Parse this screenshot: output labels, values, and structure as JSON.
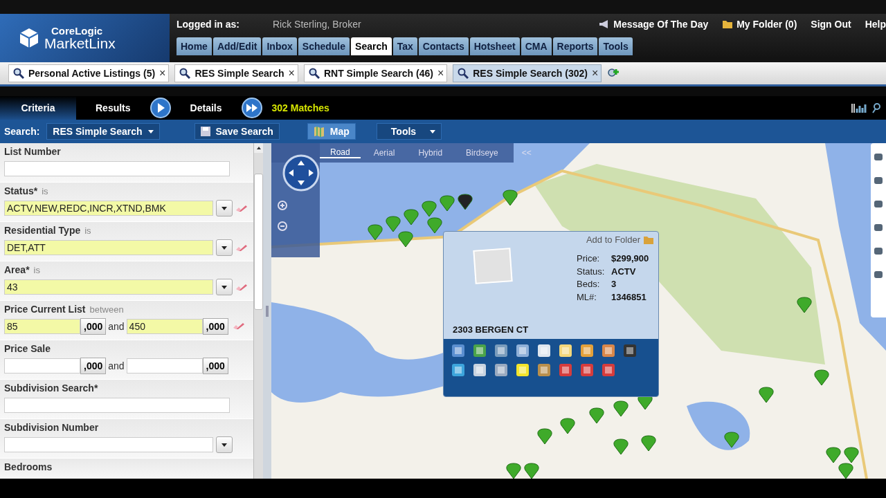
{
  "header": {
    "logo_top": "CoreLogic",
    "logo_bottom": "MarketLinx",
    "logged_in_label": "Logged in as:",
    "user": "Rick Sterling, Broker",
    "links": [
      {
        "label": "Message Of The Day",
        "kind": "message"
      },
      {
        "label": "My Folder (0)",
        "kind": "folder"
      },
      {
        "label": "Sign Out",
        "kind": "plain"
      },
      {
        "label": "Help",
        "kind": "plain"
      }
    ],
    "nav": [
      {
        "label": "Home",
        "selected": false
      },
      {
        "label": "Add/Edit",
        "selected": false
      },
      {
        "label": "Inbox",
        "selected": false
      },
      {
        "label": "Schedule",
        "selected": false
      },
      {
        "label": "Search",
        "selected": true
      },
      {
        "label": "Tax",
        "selected": false
      },
      {
        "label": "Contacts",
        "selected": false
      },
      {
        "label": "Hotsheet",
        "selected": false
      },
      {
        "label": "CMA",
        "selected": false
      },
      {
        "label": "Reports",
        "selected": false
      },
      {
        "label": "Tools",
        "selected": false
      }
    ]
  },
  "search_tabs": [
    {
      "label": "Personal Active Listings (5)",
      "close": "×",
      "selected": false
    },
    {
      "label": "RES Simple Search",
      "close": "×",
      "selected": false
    },
    {
      "label": "RNT Simple Search (46)",
      "close": "×",
      "selected": false
    },
    {
      "label": "RES Simple Search (302)",
      "close": "×",
      "selected": true
    }
  ],
  "view_tabs": [
    {
      "label": "Criteria",
      "selected": true
    },
    {
      "label": "Results",
      "selected": false
    },
    {
      "label": "Details",
      "selected": false
    }
  ],
  "matches": "302 Matches",
  "toolbar": {
    "search_label": "Search:",
    "search_value": "RES Simple Search",
    "save": "Save Search",
    "map": "Map",
    "map_selected": true,
    "tools": "Tools"
  },
  "criteria": [
    {
      "kind": "text",
      "label": "List Number",
      "highlighted": false
    },
    {
      "kind": "select",
      "label": "Status*",
      "operator": "is",
      "value": "ACTV,NEW,REDC,INCR,XTND,BMK",
      "highlighted": true,
      "clearable": true
    },
    {
      "kind": "select",
      "label": "Residential Type",
      "operator": "is",
      "value": "DET,ATT",
      "highlighted": true,
      "clearable": true
    },
    {
      "kind": "select",
      "label": "Area*",
      "operator": "is",
      "value": "43",
      "highlighted": true,
      "clearable": true
    },
    {
      "kind": "range",
      "label": "Price Current List",
      "operator": "between",
      "from": "85",
      "to": "450",
      "from_unit": ",000",
      "to_unit": ",000",
      "joiner": "and",
      "highlighted": true,
      "clearable": true
    },
    {
      "kind": "range",
      "label": "Price Sale",
      "from_unit": ",000",
      "to_unit": ",000",
      "joiner": "and",
      "highlighted": false
    },
    {
      "kind": "text",
      "label": "Subdivision Search*",
      "highlighted": false
    },
    {
      "kind": "select",
      "label": "Subdivision Number",
      "highlighted": false
    },
    {
      "kind": "label",
      "label": "Bedrooms"
    }
  ],
  "map": {
    "modes": [
      {
        "label": "Road",
        "selected": true
      },
      {
        "label": "Aerial",
        "selected": false
      },
      {
        "label": "Hybrid",
        "selected": false
      },
      {
        "label": "Birdseye",
        "selected": false
      }
    ],
    "collapse": "<<",
    "popup": {
      "add_to_folder": "Add to Folder",
      "facts": [
        {
          "label": "Price:",
          "value": "$299,900"
        },
        {
          "label": "Status:",
          "value": "ACTV"
        },
        {
          "label": "Beds:",
          "value": "3"
        },
        {
          "label": "ML#:",
          "value": "1346851"
        }
      ],
      "address": "2303 BERGEN CT"
    }
  }
}
